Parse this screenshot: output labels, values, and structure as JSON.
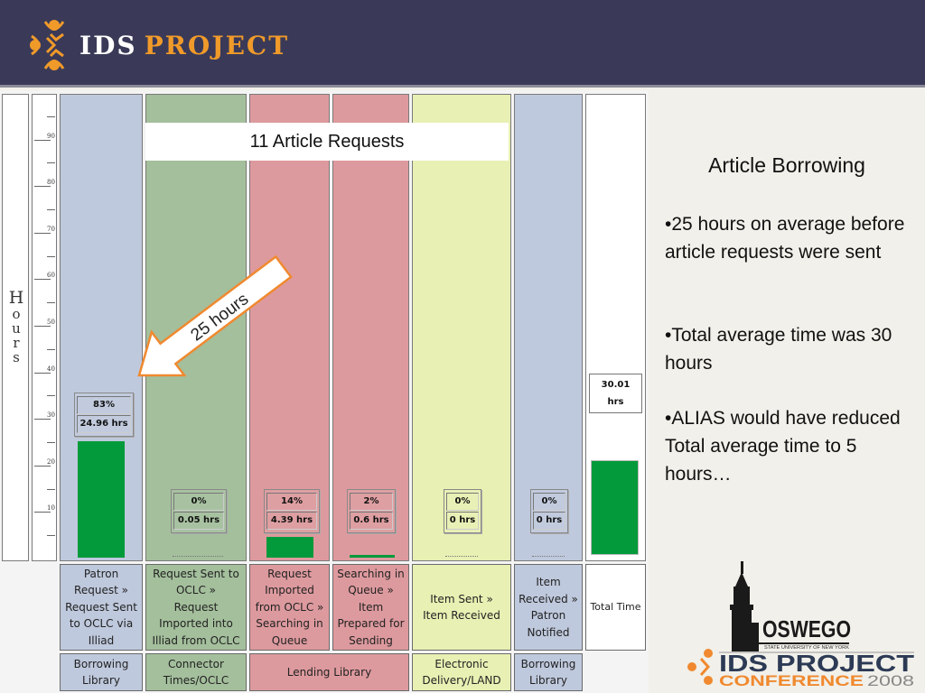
{
  "header": {
    "logo_icon": "ids-people-icon",
    "logo_text_ids": "IDS",
    "logo_text_project": "PROJECT"
  },
  "chart_data": {
    "type": "bar",
    "title": "11 Article Requests",
    "ylabel": "Hours",
    "ylabel_letters": [
      "H",
      "o",
      "u",
      "r",
      "s"
    ],
    "ylim": [
      0,
      100
    ],
    "yticks_labeled": [
      10,
      20,
      30,
      40,
      50,
      60,
      70,
      80,
      90
    ],
    "categories": [
      "Patron Request » Request Sent to OCLC via Illiad",
      "Request Sent to OCLC » Request Imported into Illiad from OCLC",
      "Request Imported from OCLC » Searching in Queue",
      "Searching in Queue » Item Prepared for Sending",
      "Item Sent » Item Received",
      "Item Received » Patron Notified",
      "Total Time"
    ],
    "groups": [
      "Borrowing Library",
      "Connector Times/OCLC",
      "Lending Library",
      "Lending Library",
      "Electronic Delivery/LAND",
      "Borrowing Library",
      ""
    ],
    "values": [
      24.96,
      0.05,
      4.39,
      0.6,
      0,
      0,
      30.01
    ],
    "percent_labels": [
      "83%",
      "0%",
      "14%",
      "2%",
      "0%",
      "0%",
      ""
    ],
    "value_labels": [
      "24.96 hrs",
      "0.05 hrs",
      "4.39 hrs",
      "0.6 hrs",
      "0 hrs",
      "0 hrs",
      "30.01 hrs"
    ],
    "total_label_line1": "30.01",
    "total_label_line2": "hrs",
    "annotation": "25 hours",
    "colors": {
      "bar": "#029a3a",
      "borrowing": "#bfc9dd",
      "connector": "#a4bf9c",
      "lending": "#dd9a9e",
      "delivery": "#e8f0b3",
      "total": "#ffffff",
      "arrow_border": "#f0892f"
    }
  },
  "column_labels": [
    {
      "stage": "Patron\nRequest »\nRequest Sent\nto OCLC via\nIlliad",
      "group": "Borrowing\nLibrary"
    },
    {
      "stage": "Request Sent to\nOCLC »\nRequest\nImported into\nIlliad from OCLC",
      "group": "Connector\nTimes/OCLC"
    },
    {
      "stage": "Request\nImported\nfrom OCLC »\nSearching in\nQueue",
      "group": "Lending Library"
    },
    {
      "stage": "Searching in\nQueue »\nItem\nPrepared for\nSending",
      "group": ""
    },
    {
      "stage": "Item Sent »\nItem Received",
      "group": "Electronic\nDelivery/LAND"
    },
    {
      "stage": "Item\nReceived »\nPatron\nNotified",
      "group": "Borrowing\nLibrary"
    },
    {
      "stage": "Total Time",
      "group": ""
    }
  ],
  "right_panel": {
    "title": "Article Borrowing",
    "bullets": [
      "•25 hours on average before article requests were sent",
      "•Total average time was 30 hours",
      "•ALIAS would have reduced Total average time to 5 hours…"
    ]
  },
  "conference_logo": {
    "university": "OSWEGO",
    "university_sub": "STATE UNIVERSITY OF NEW YORK",
    "line1": "IDS PROJECT",
    "line2": "CONFERENCE",
    "year": "2008"
  }
}
